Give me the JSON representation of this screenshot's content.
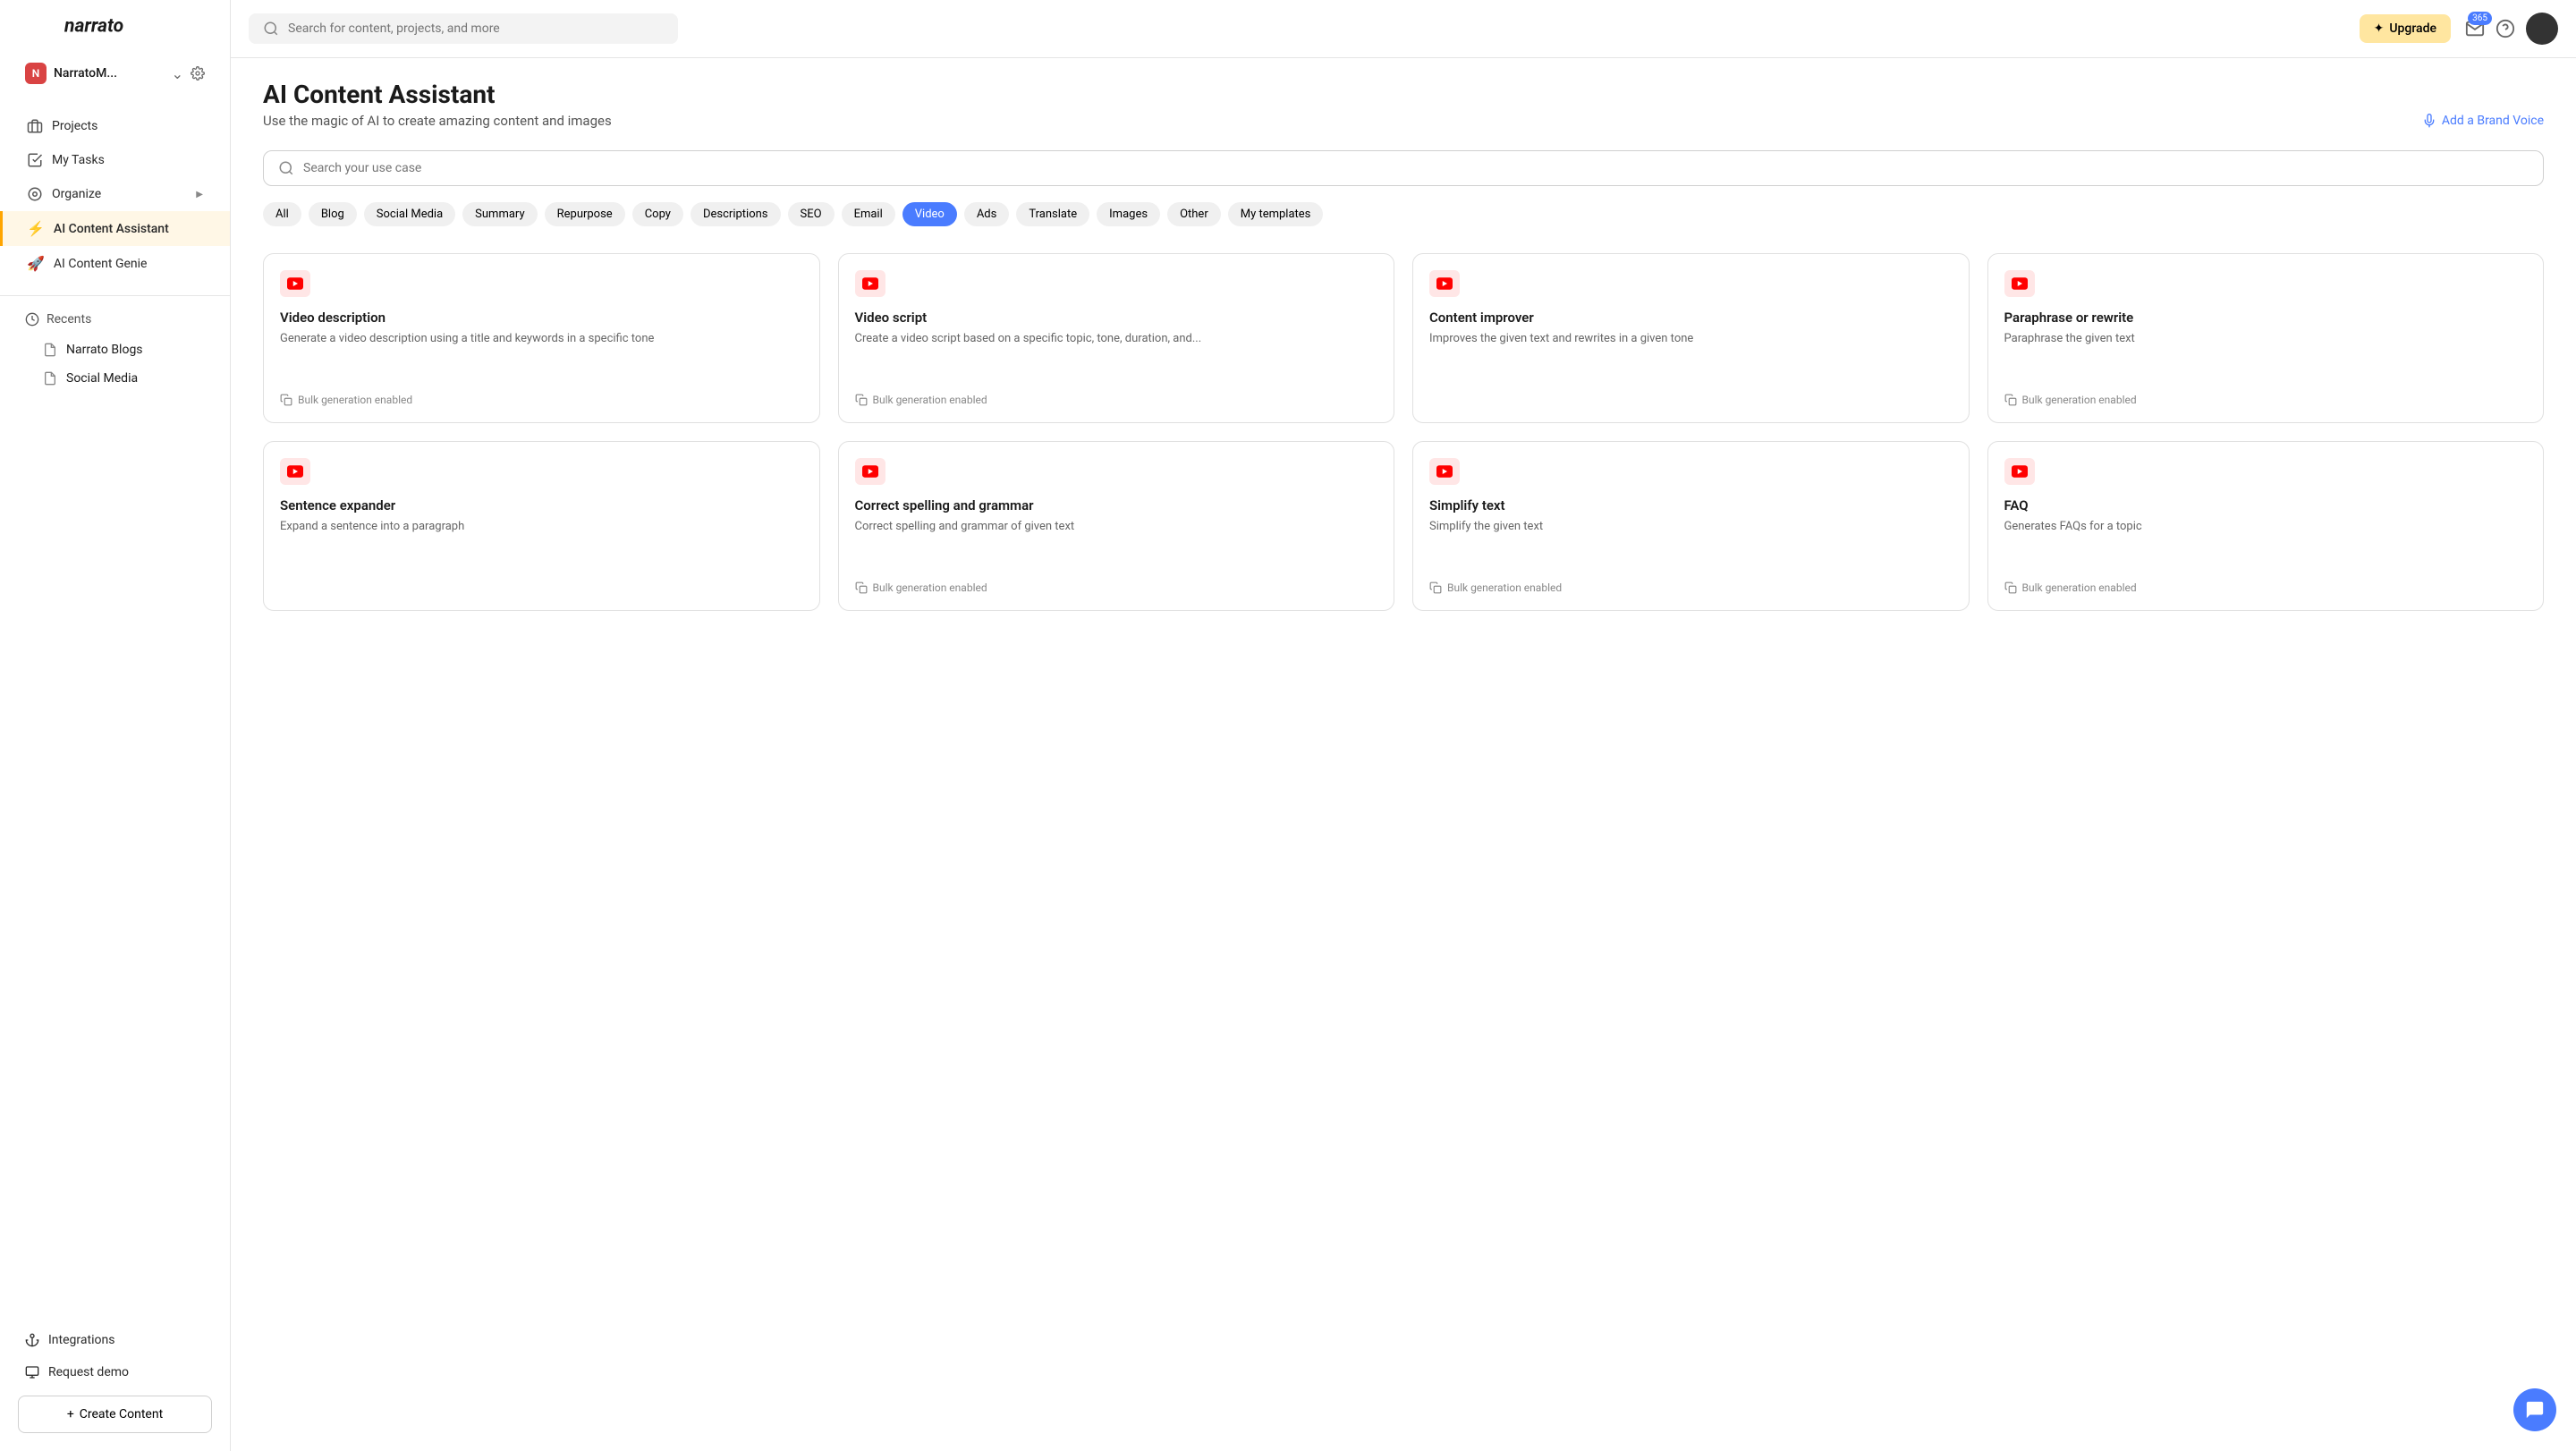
{
  "workspace": {
    "badge": "N",
    "name": "NarratoM..."
  },
  "sidebar": {
    "nav": [
      {
        "label": "Projects"
      },
      {
        "label": "My Tasks"
      },
      {
        "label": "Organize"
      },
      {
        "label": "AI Content Assistant"
      },
      {
        "label": "AI Content Genie"
      }
    ],
    "recents_label": "Recents",
    "recents": [
      {
        "label": "Narrato Blogs"
      },
      {
        "label": "Social Media"
      }
    ],
    "integrations": "Integrations",
    "request_demo": "Request demo",
    "create_content": "Create Content"
  },
  "topbar": {
    "search_placeholder": "Search for content, projects, and more",
    "upgrade": "Upgrade",
    "notif_count": "365"
  },
  "page": {
    "title": "AI Content Assistant",
    "subtitle": "Use the magic of AI to create amazing content and images",
    "brand_voice": "Add a Brand Voice",
    "usecase_placeholder": "Search your use case"
  },
  "filters": [
    "All",
    "Blog",
    "Social Media",
    "Summary",
    "Repurpose",
    "Copy",
    "Descriptions",
    "SEO",
    "Email",
    "Video",
    "Ads",
    "Translate",
    "Images",
    "Other",
    "My templates"
  ],
  "active_filter": "Video",
  "bulk_label": "Bulk generation enabled",
  "cards": [
    {
      "title": "Video description",
      "desc": "Generate a video description using a title and keywords in a specific tone",
      "bulk": true
    },
    {
      "title": "Video script",
      "desc": "Create a video script based on a specific topic, tone, duration, and...",
      "bulk": true
    },
    {
      "title": "Content improver",
      "desc": "Improves the given text and rewrites in a given tone",
      "bulk": false
    },
    {
      "title": "Paraphrase or rewrite",
      "desc": "Paraphrase the given text",
      "bulk": true
    },
    {
      "title": "Sentence expander",
      "desc": "Expand a sentence into a paragraph",
      "bulk": false
    },
    {
      "title": "Correct spelling and grammar",
      "desc": "Correct spelling and grammar of given text",
      "bulk": true
    },
    {
      "title": "Simplify text",
      "desc": "Simplify the given text",
      "bulk": true
    },
    {
      "title": "FAQ",
      "desc": "Generates FAQs for a topic",
      "bulk": true
    }
  ]
}
